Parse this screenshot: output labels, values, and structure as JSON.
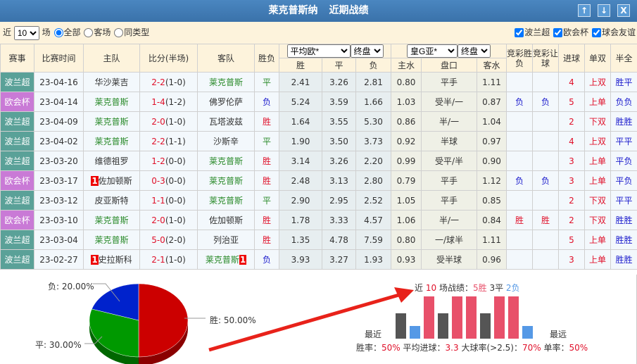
{
  "title": {
    "team": "莱克普斯纳",
    "label": "近期战绩",
    "btn_up": "↑",
    "btn_down": "↓",
    "btn_close": "X"
  },
  "filter": {
    "prefix": "近",
    "count": "10",
    "suffix": "场",
    "options": [
      "全部",
      "客场",
      "同类型"
    ],
    "selected": "全部",
    "leagues": [
      "波兰超",
      "欧会杯",
      "球会友谊"
    ]
  },
  "headers": {
    "league": "赛事",
    "time": "比赛时间",
    "home": "主队",
    "score": "比分(半场)",
    "away": "客队",
    "result": "胜负",
    "eu_company": "平均欧*",
    "eu_type": "终盘",
    "ah_company": "皇G亚*",
    "ah_type": "终盘",
    "win": "胜",
    "draw": "平",
    "lose": "负",
    "home_w": "主水",
    "handicap": "盘口",
    "away_w": "客水",
    "jc_wl": "竞彩胜负",
    "jc_hc": "竞彩让球",
    "goals": "进球",
    "oe": "单双",
    "hf": "半全"
  },
  "rows": [
    {
      "league": "波兰超",
      "lt": 1,
      "time": "23-04-16",
      "home": "华沙莱吉",
      "hg": 0,
      "hr": "",
      "score": "2-2",
      "half": "(1-0)",
      "away": "莱克普斯",
      "ag": 1,
      "ar": "",
      "res": "平",
      "w": "2.41",
      "d": "3.26",
      "l": "2.81",
      "hw": "0.80",
      "hc": "平手",
      "aw": "1.11",
      "jw": "",
      "jh": "",
      "goals": "4",
      "oe": "上双",
      "hf": "胜平"
    },
    {
      "league": "欧会杯",
      "lt": 2,
      "time": "23-04-14",
      "home": "莱克普斯",
      "hg": 1,
      "hr": "",
      "score": "1-4",
      "half": "(1-2)",
      "away": "佛罗伦萨",
      "ag": 0,
      "ar": "",
      "res": "负",
      "w": "5.24",
      "d": "3.59",
      "l": "1.66",
      "hw": "1.03",
      "hc": "受半/一",
      "aw": "0.87",
      "jw": "负",
      "jh": "负",
      "goals": "5",
      "oe": "上单",
      "hf": "负负"
    },
    {
      "league": "波兰超",
      "lt": 1,
      "time": "23-04-09",
      "home": "莱克普斯",
      "hg": 1,
      "hr": "",
      "score": "2-0",
      "half": "(1-0)",
      "away": "瓦塔波兹",
      "ag": 0,
      "ar": "",
      "res": "胜",
      "w": "1.64",
      "d": "3.55",
      "l": "5.30",
      "hw": "0.86",
      "hc": "半/一",
      "aw": "1.04",
      "jw": "",
      "jh": "",
      "goals": "2",
      "oe": "下双",
      "hf": "胜胜"
    },
    {
      "league": "波兰超",
      "lt": 1,
      "time": "23-04-02",
      "home": "莱克普斯",
      "hg": 1,
      "hr": "",
      "score": "2-2",
      "half": "(1-1)",
      "away": "沙斯辛",
      "ag": 0,
      "ar": "",
      "res": "平",
      "w": "1.90",
      "d": "3.50",
      "l": "3.73",
      "hw": "0.92",
      "hc": "半球",
      "aw": "0.97",
      "jw": "",
      "jh": "",
      "goals": "4",
      "oe": "上双",
      "hf": "平平"
    },
    {
      "league": "波兰超",
      "lt": 1,
      "time": "23-03-20",
      "home": "维德祖罗",
      "hg": 0,
      "hr": "",
      "score": "1-2",
      "half": "(0-0)",
      "away": "莱克普斯",
      "ag": 1,
      "ar": "",
      "res": "胜",
      "w": "3.14",
      "d": "3.26",
      "l": "2.20",
      "hw": "0.99",
      "hc": "受平/半",
      "aw": "0.90",
      "jw": "",
      "jh": "",
      "goals": "3",
      "oe": "上单",
      "hf": "平负"
    },
    {
      "league": "欧会杯",
      "lt": 2,
      "time": "23-03-17",
      "home": "佐加顿斯",
      "hg": 0,
      "hr": "1",
      "score": "0-3",
      "half": "(0-0)",
      "away": "莱克普斯",
      "ag": 1,
      "ar": "",
      "res": "胜",
      "w": "2.48",
      "d": "3.13",
      "l": "2.80",
      "hw": "0.79",
      "hc": "平手",
      "aw": "1.12",
      "jw": "负",
      "jh": "负",
      "goals": "3",
      "oe": "上单",
      "hf": "平负"
    },
    {
      "league": "波兰超",
      "lt": 1,
      "time": "23-03-12",
      "home": "皮亚斯特",
      "hg": 0,
      "hr": "",
      "score": "1-1",
      "half": "(0-0)",
      "away": "莱克普斯",
      "ag": 1,
      "ar": "",
      "res": "平",
      "w": "2.90",
      "d": "2.95",
      "l": "2.52",
      "hw": "1.05",
      "hc": "平手",
      "aw": "0.85",
      "jw": "",
      "jh": "",
      "goals": "2",
      "oe": "下双",
      "hf": "平平"
    },
    {
      "league": "欧会杯",
      "lt": 2,
      "time": "23-03-10",
      "home": "莱克普斯",
      "hg": 1,
      "hr": "",
      "score": "2-0",
      "half": "(1-0)",
      "away": "佐加顿斯",
      "ag": 0,
      "ar": "",
      "res": "胜",
      "w": "1.78",
      "d": "3.33",
      "l": "4.57",
      "hw": "1.06",
      "hc": "半/一",
      "aw": "0.84",
      "jw": "胜",
      "jh": "胜",
      "goals": "2",
      "oe": "下双",
      "hf": "胜胜"
    },
    {
      "league": "波兰超",
      "lt": 1,
      "time": "23-03-04",
      "home": "莱克普斯",
      "hg": 1,
      "hr": "",
      "score": "5-0",
      "half": "(2-0)",
      "away": "列治亚",
      "ag": 0,
      "ar": "",
      "res": "胜",
      "w": "1.35",
      "d": "4.78",
      "l": "7.59",
      "hw": "0.80",
      "hc": "一/球半",
      "aw": "1.11",
      "jw": "",
      "jh": "",
      "goals": "5",
      "oe": "上单",
      "hf": "胜胜"
    },
    {
      "league": "波兰超",
      "lt": 1,
      "time": "23-02-27",
      "home": "史拉斯科",
      "hg": 0,
      "hr": "1",
      "score": "2-1",
      "half": "(1-0)",
      "away": "莱克普斯",
      "ag": 1,
      "ar": "1",
      "res": "负",
      "w": "3.93",
      "d": "3.27",
      "l": "1.93",
      "hw": "0.93",
      "hc": "受半球",
      "aw": "0.96",
      "jw": "",
      "jh": "",
      "goals": "3",
      "oe": "上单",
      "hf": "胜胜"
    }
  ],
  "pie": {
    "win": "胜: 50.00%",
    "draw": "平: 30.00%",
    "lose": "负: 20.00%",
    "values": [
      50,
      30,
      20
    ],
    "colors": [
      "#cc0000",
      "#009900",
      "#0022cc"
    ]
  },
  "summary": {
    "p1": "近",
    "n": "10",
    "p2": "场战绩：",
    "w": "5胜",
    "d": "3平",
    "l": "2负",
    "recent": "最近",
    "far": "最远",
    "results": [
      "平",
      "负",
      "胜",
      "平",
      "胜",
      "胜",
      "平",
      "胜",
      "胜",
      "负"
    ],
    "win_rate_label": "胜率：",
    "win_rate": "50%",
    "avg_label": "平均进球：",
    "avg": "3.3",
    "big_label": "大球率(>2.5)：",
    "big": "70%",
    "odd_label": "单率：",
    "odd": "50%"
  },
  "colors": {
    "win": "#e8506a",
    "draw": "#555555",
    "lose": "#5599e6"
  }
}
